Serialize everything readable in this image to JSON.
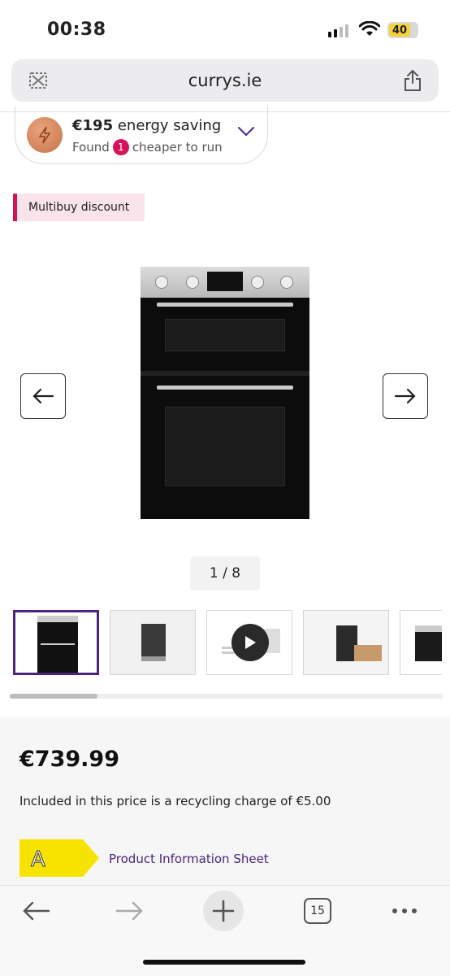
{
  "status_bar": {
    "time": "00:38",
    "battery": "40",
    "signal_icon": "cellular-signal-icon",
    "wifi_icon": "wifi-icon"
  },
  "browser": {
    "url": "currys.ie",
    "left_icon": "tracker-shield-icon",
    "share_icon": "share-icon"
  },
  "energy": {
    "amount": "€195",
    "title_suffix": "energy saving",
    "found_label": "Found",
    "count": "1",
    "sub_suffix": "cheaper to run",
    "icon": "lightning-bolt-icon"
  },
  "multibuy_label": "Multibuy discount",
  "gallery": {
    "counter": "1 / 8",
    "prev_icon": "arrow-left-icon",
    "next_icon": "arrow-right-icon",
    "current_index": 1,
    "total": 8
  },
  "thumbnails": [
    {
      "name": "oven-front",
      "active": true
    },
    {
      "name": "oven-in-kitchen",
      "active": false
    },
    {
      "name": "video",
      "active": false
    },
    {
      "name": "oven-side",
      "active": false
    },
    {
      "name": "oven-partial",
      "active": false
    }
  ],
  "price_block": {
    "price": "€739.99",
    "recycling_text": "Included in this price is a recycling charge of €5.00",
    "energy_rating": "A",
    "info_link": "Product Information Sheet"
  },
  "bottom_nav": {
    "tabs_count": "15"
  },
  "colors": {
    "brand_purple": "#4a2583",
    "accent_pink": "#d4145a",
    "energy_yellow": "#f7e300"
  }
}
